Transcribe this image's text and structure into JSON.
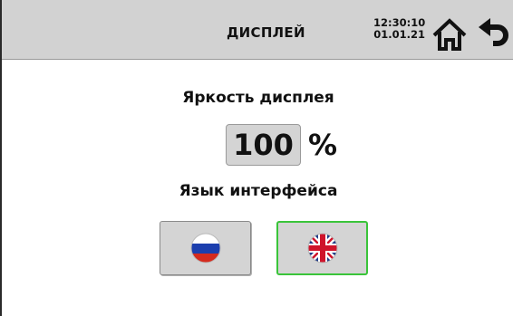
{
  "header": {
    "title": "ДИСПЛЕЙ",
    "time": "12:30:10",
    "date": "01.01.21",
    "home_icon": "home-icon",
    "back_icon": "back-arrow-icon",
    "background": "#d2d2d2"
  },
  "brightness": {
    "label": "Яркость дисплея",
    "value": "100",
    "unit": "%"
  },
  "language": {
    "label": "Язык интерфейса",
    "options": [
      {
        "icon": "russian-flag-icon",
        "selected": false
      },
      {
        "icon": "uk-flag-icon",
        "selected": true
      }
    ],
    "selected_border_color": "#3ac43a"
  }
}
